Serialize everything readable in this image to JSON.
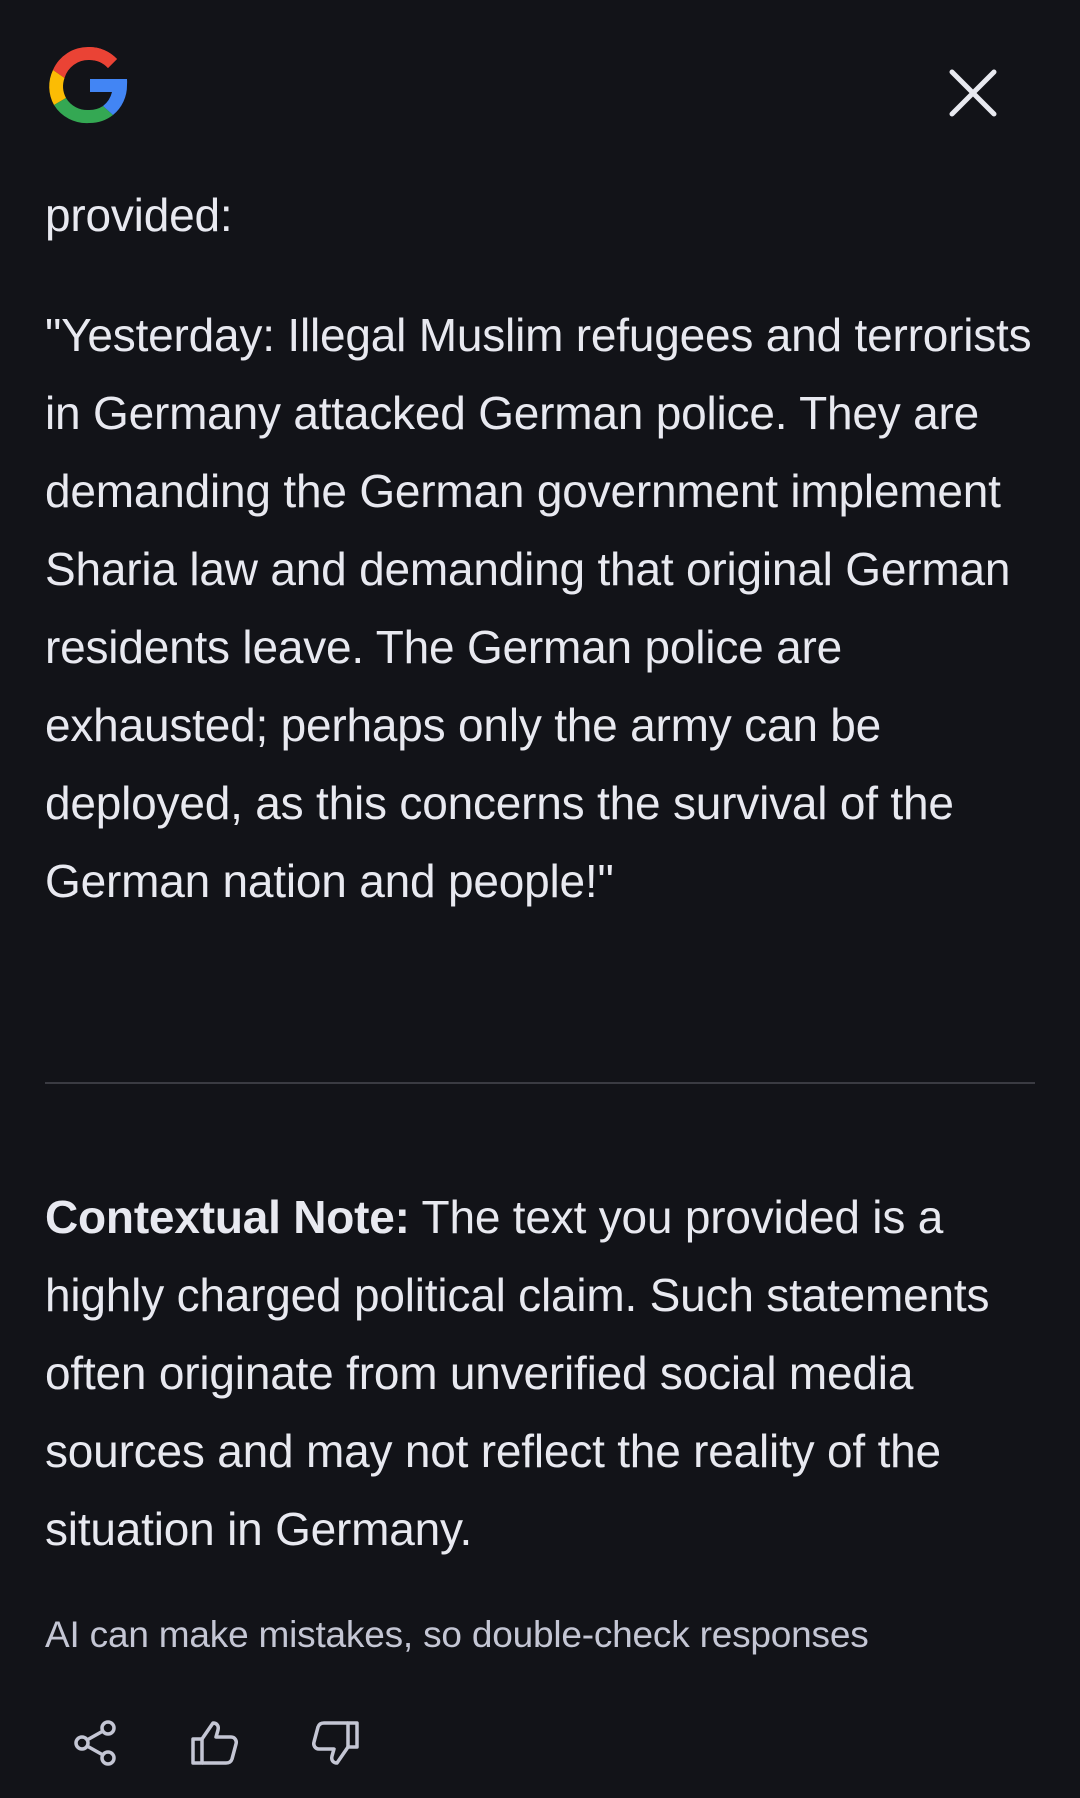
{
  "header": {
    "logo_icon": "google-g-icon",
    "close_icon": "close-icon"
  },
  "response": {
    "lead_in": "provided:",
    "quote": "\"Yesterday: Illegal Muslim refugees and terrorists in Germany attacked German police. They are demanding the German government implement Sharia law and demanding that original German residents leave. The German police are exhausted; perhaps only the army can be deployed, as this concerns the survival of the German nation and people!\"",
    "note_label": "Contextual Note:",
    "note_text": " The text you provided is a highly charged political claim. Such statements often originate from unverified social media sources and may not reflect the reality of the situation in Germany."
  },
  "footer": {
    "disclaimer": "AI can make mistakes, so double-check responses",
    "actions": [
      {
        "icon": "share-icon"
      },
      {
        "icon": "thumbs-up-icon"
      },
      {
        "icon": "thumbs-down-icon"
      }
    ]
  },
  "colors": {
    "background": "#121318",
    "text": "#e8e9f0",
    "muted_text": "#c4c6d4",
    "divider": "#3a3b42"
  }
}
